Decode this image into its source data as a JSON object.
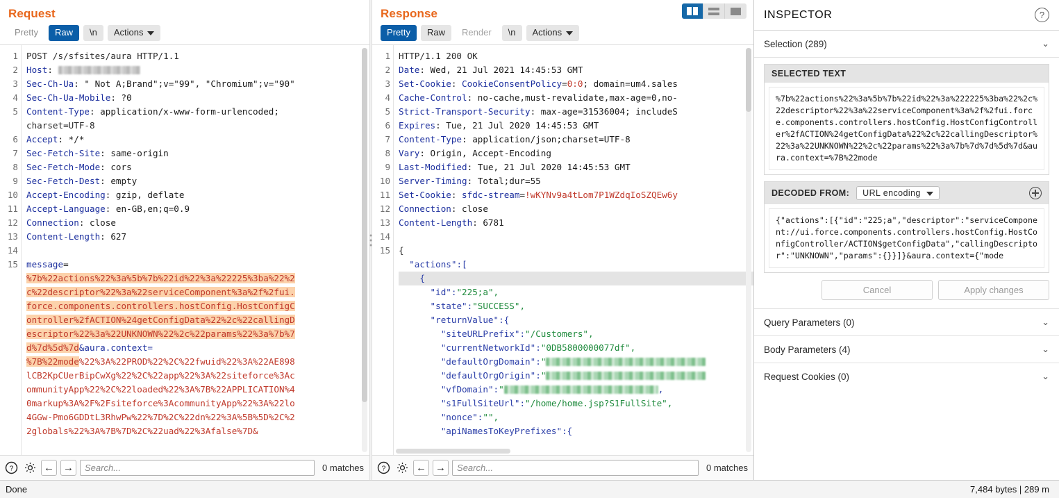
{
  "request": {
    "title": "Request",
    "tabs": [
      {
        "label": "Pretty",
        "state": "normal"
      },
      {
        "label": "Raw",
        "state": "selected"
      },
      {
        "label": "\\n",
        "state": "normal"
      },
      {
        "label": "Actions",
        "state": "menu"
      }
    ],
    "line_numbers": [
      "1",
      "2",
      "3",
      "4",
      "5",
      "",
      "6",
      "7",
      "8",
      "9",
      "10",
      "11",
      "12",
      "13",
      "14",
      "15"
    ],
    "lines": [
      {
        "n": "1",
        "type": "plain",
        "text": "POST /s/sfsites/aura HTTP/1.1"
      },
      {
        "n": "2",
        "type": "header",
        "key": "Host",
        "value": "",
        "redacted": true,
        "redact_width": 118
      },
      {
        "n": "3",
        "type": "header",
        "key": "Sec-Ch-Ua",
        "value": " \" Not A;Brand\";v=\"99\", \"Chromium\";v=\"90\""
      },
      {
        "n": "4",
        "type": "header",
        "key": "Sec-Ch-Ua-Mobile",
        "value": " ?0"
      },
      {
        "n": "5",
        "type": "header",
        "key": "Content-Type",
        "value": " application/x-www-form-urlencoded;"
      },
      {
        "n": "",
        "type": "plain",
        "text": "charset=UTF-8"
      },
      {
        "n": "6",
        "type": "header",
        "key": "Accept",
        "value": " */*"
      },
      {
        "n": "7",
        "type": "header",
        "key": "Sec-Fetch-Site",
        "value": " same-origin"
      },
      {
        "n": "8",
        "type": "header",
        "key": "Sec-Fetch-Mode",
        "value": " cors"
      },
      {
        "n": "9",
        "type": "header",
        "key": "Sec-Fetch-Dest",
        "value": " empty"
      },
      {
        "n": "10",
        "type": "header",
        "key": "Accept-Encoding",
        "value": " gzip, deflate"
      },
      {
        "n": "11",
        "type": "header",
        "key": "Accept-Language",
        "value": " en-GB,en;q=0.9"
      },
      {
        "n": "12",
        "type": "header",
        "key": "Connection",
        "value": " close"
      },
      {
        "n": "13",
        "type": "header",
        "key": "Content-Length",
        "value": " 627"
      },
      {
        "n": "14",
        "type": "plain",
        "text": ""
      },
      {
        "n": "15",
        "type": "param",
        "key": "message",
        "value": ""
      }
    ],
    "body_selected": [
      "%7b%22actions%22%3a%5b%7b%22id%22%3a%22225%3ba%22%2",
      "c%22descriptor%22%3a%22serviceComponent%3a%2f%2fui.",
      "force.components.controllers.hostConfig.HostConfigC",
      "ontroller%2fACTION%24getConfigData%22%2c%22callingD",
      "escriptor%22%3a%22UNKNOWN%22%2c%22params%22%3a%7b%7",
      "d%7d%5d%7d"
    ],
    "body_param_name": "&aura.context=",
    "body_selected_tail": "%7B%22mode",
    "body_rest": [
      "%22%3A%22PROD%22%2C%22fwuid%22%3A%22AE898",
      "lCB2KpCUerBipCwXg%22%2C%22app%22%3A%22siteforce%3Ac",
      "ommunityApp%22%2C%22loaded%22%3A%7B%22APPLICATION%4",
      "0markup%3A%2F%2Fsiteforce%3AcommunityApp%22%3A%22lo",
      "4GGw-Pmo6GDDtL3RhwPw%22%7D%2C%22dn%22%3A%5B%5D%2C%2",
      "2globals%22%3A%7B%7D%2C%22uad%22%3Afalse%7D&"
    ],
    "find": {
      "placeholder": "Search...",
      "matches": "0 matches"
    }
  },
  "response": {
    "title": "Response",
    "tabs": [
      {
        "label": "Pretty",
        "state": "selected"
      },
      {
        "label": "Raw",
        "state": "normal"
      },
      {
        "label": "Render",
        "state": "disabled"
      },
      {
        "label": "\\n",
        "state": "normal"
      },
      {
        "label": "Actions",
        "state": "menu"
      }
    ],
    "layout_buttons": [
      {
        "name": "split-view",
        "selected": true
      },
      {
        "name": "stacked-view",
        "selected": false
      },
      {
        "name": "single-view",
        "selected": false
      }
    ],
    "lines": [
      {
        "n": "1",
        "type": "plain",
        "text": "HTTP/1.1 200 OK"
      },
      {
        "n": "2",
        "type": "header",
        "key": "Date",
        "value": " Wed, 21 Jul 2021 14:45:53 GMT"
      },
      {
        "n": "3",
        "type": "cookie",
        "key": "Set-Cookie",
        "cname": "CookieConsentPolicy",
        "cval": "0:0",
        "rest": "; domain=um4.sales"
      },
      {
        "n": "4",
        "type": "header",
        "key": "Cache-Control",
        "value": " no-cache,must-revalidate,max-age=0,no-"
      },
      {
        "n": "5",
        "type": "header",
        "key": "Strict-Transport-Security",
        "value": " max-age=31536004; includeS"
      },
      {
        "n": "6",
        "type": "header",
        "key": "Expires",
        "value": " Tue, 21 Jul 2020 14:45:53 GMT"
      },
      {
        "n": "7",
        "type": "header",
        "key": "Content-Type",
        "value": " application/json;charset=UTF-8"
      },
      {
        "n": "8",
        "type": "header",
        "key": "Vary",
        "value": " Origin, Accept-Encoding"
      },
      {
        "n": "9",
        "type": "header",
        "key": "Last-Modified",
        "value": " Tue, 21 Jul 2020 14:45:53 GMT"
      },
      {
        "n": "10",
        "type": "header",
        "key": "Server-Timing",
        "value": " Total;dur=55"
      },
      {
        "n": "11",
        "type": "cookie",
        "key": "Set-Cookie",
        "cname": "sfdc-stream",
        "cval": "!wKYNv9a4tLom7P1WZdqIoSZQEw6y",
        "rest": ""
      },
      {
        "n": "12",
        "type": "header",
        "key": "Connection",
        "value": " close"
      },
      {
        "n": "13",
        "type": "header",
        "key": "Content-Length",
        "value": " 6781"
      },
      {
        "n": "14",
        "type": "plain",
        "text": ""
      },
      {
        "n": "15",
        "type": "plain",
        "text": "{"
      }
    ],
    "json_lines": [
      {
        "indent": 2,
        "key": "\"actions\"",
        "sep": ":[",
        "val": "",
        "highlight": false
      },
      {
        "indent": 4,
        "key": "",
        "sep": "{",
        "val": "",
        "highlight": true
      },
      {
        "indent": 6,
        "key": "\"id\"",
        "sep": ":",
        "val": "\"225;a\",",
        "highlight": false
      },
      {
        "indent": 6,
        "key": "\"state\"",
        "sep": ":",
        "val": "\"SUCCESS\",",
        "highlight": false
      },
      {
        "indent": 6,
        "key": "\"returnValue\"",
        "sep": ":{",
        "val": "",
        "highlight": false
      },
      {
        "indent": 8,
        "key": "\"siteURLPrefix\"",
        "sep": ":",
        "val": "\"/Customers\",",
        "highlight": false
      },
      {
        "indent": 8,
        "key": "\"currentNetworkId\"",
        "sep": ":",
        "val": "\"0DB5800000077df\",",
        "highlight": false
      },
      {
        "indent": 8,
        "key": "\"defaultOrgDomain\"",
        "sep": ":",
        "val": "\"",
        "redact": 230,
        "highlight": false
      },
      {
        "indent": 8,
        "key": "\"defaultOrgOrigin\"",
        "sep": ":",
        "val": "\"",
        "redact": 230,
        "highlight": false
      },
      {
        "indent": 8,
        "key": "\"vfDomain\"",
        "sep": ":",
        "val": "\"",
        "redact": 222,
        "tail": ",",
        "highlight": false
      },
      {
        "indent": 8,
        "key": "\"s1FullSiteUrl\"",
        "sep": ":",
        "val": "\"/home/home.jsp?S1FullSite\",",
        "highlight": false
      },
      {
        "indent": 8,
        "key": "\"nonce\"",
        "sep": ":",
        "val": "\"\",",
        "highlight": false
      },
      {
        "indent": 8,
        "key": "\"apiNamesToKeyPrefixes\"",
        "sep": ":{",
        "val": "",
        "highlight": false
      }
    ],
    "find": {
      "placeholder": "Search...",
      "matches": "0 matches"
    }
  },
  "inspector": {
    "title": "INSPECTOR",
    "help_icon_label": "?",
    "sections": [
      {
        "label": "Selection (289)",
        "state": "expanded"
      },
      {
        "label": "Query Parameters (0)",
        "state": "collapsed"
      },
      {
        "label": "Body Parameters (4)",
        "state": "collapsed"
      },
      {
        "label": "Request Cookies (0)",
        "state": "collapsed"
      }
    ],
    "selected_text_label": "SELECTED TEXT",
    "selected_text_value": "%7b%22actions%22%3a%5b%7b%22id%22%3a%222225%3ba%22%2c%22descriptor%22%3a%22serviceComponent%3a%2f%2fui.force.components.controllers.hostConfig.HostConfigController%2fACTION%24getConfigData%22%2c%22callingDescriptor%22%3a%22UNKNOWN%22%2c%22params%22%3a%7b%7d%7d%5d%7d&aura.context=%7B%22mode",
    "decoded_from_label": "DECODED FROM:",
    "decoded_from_value": "URL encoding",
    "decoded_text_value": "{\"actions\":[{\"id\":\"225;a\",\"descriptor\":\"serviceComponent://ui.force.components.controllers.hostConfig.HostConfigController/ACTION$getConfigData\",\"callingDescriptor\":\"UNKNOWN\",\"params\":{}}]}&aura.context={\"mode",
    "cancel_label": "Cancel",
    "apply_label": "Apply changes"
  },
  "statusbar": {
    "left": "Done",
    "right": "7,484 bytes | 289 m"
  },
  "colors": {
    "accent_orange": "#e8671c",
    "selected_blue": "#0b5ea8",
    "highlight_orange": "#fcd2ab",
    "json_value_green": "#1e8a3c",
    "header_key_blue": "#1c2f9e",
    "cookie_value_red": "#c0392b"
  }
}
